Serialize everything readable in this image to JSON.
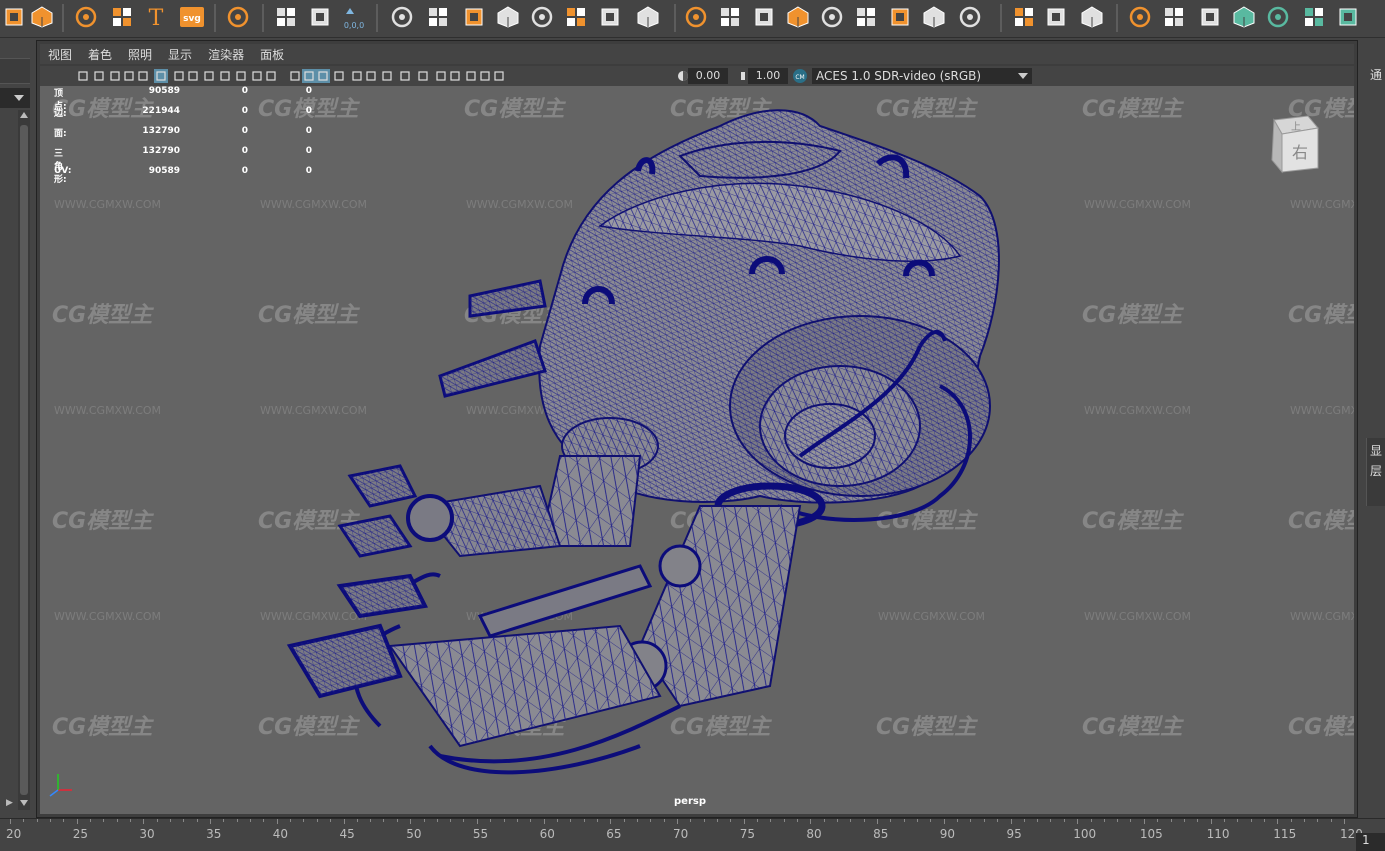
{
  "shelf": {
    "icons": [
      "partial-icon",
      "polygon-sphere-icon",
      "sparkle-icon",
      "spring-helix-icon",
      "text-T-icon",
      "svg-icon",
      "grid-panel-icon",
      "target-icon",
      "scale-cursor-icon",
      "pivot-reset-icon",
      "combine-icon",
      "boolean-icon",
      "extract-icon",
      "separate-icon",
      "smooth-icon",
      "cleanup-icon",
      "transfer-icon",
      "mirror-icon",
      "extrude-icon",
      "bridge-icon",
      "bevel-icon",
      "append-icon",
      "multicut-icon",
      "fill-hole-icon",
      "wedge-icon",
      "poke-icon",
      "circularize-icon",
      "combine-edges-icon",
      "target-weld-icon",
      "edge-flow-icon",
      "pencil-icon",
      "lattice-icon",
      "paint-icon",
      "uv-cube-icon",
      "uv-cylinder-icon",
      "uv-planar-icon",
      "uv-layout-icon",
      "uv-unfold-icon",
      "uv-checker-icon",
      "uv-grid-icon"
    ],
    "svg_label": "svg",
    "coord_label": "0,0,0"
  },
  "left": {
    "bottom_arrow": "▶"
  },
  "right": {
    "top_label": "通",
    "mid_label_1": "显",
    "mid_label_2": "层"
  },
  "viewport_menu": {
    "items": [
      "视图",
      "着色",
      "照明",
      "显示",
      "渲染器",
      "面板"
    ]
  },
  "viewport_toolbar": {
    "exposure": "0.00",
    "gamma": "1.00",
    "color_space": "ACES 1.0 SDR-video (sRGB)"
  },
  "hud": {
    "rows": [
      {
        "label": "顶点:",
        "v1": "90589",
        "v2": "0",
        "v3": "0"
      },
      {
        "label": "边:",
        "v1": "221944",
        "v2": "0",
        "v3": "0"
      },
      {
        "label": "面:",
        "v1": "132790",
        "v2": "0",
        "v3": "0"
      },
      {
        "label": "三角形:",
        "v1": "132790",
        "v2": "0",
        "v3": "0"
      },
      {
        "label": "UV:",
        "v1": "90589",
        "v2": "0",
        "v3": "0"
      }
    ]
  },
  "viewcube": {
    "face_top": "上",
    "face_right": "右"
  },
  "camera": "persp",
  "watermark": {
    "logo": "CG模型主",
    "url": "WWW.CGMXW.COM"
  },
  "timeline": {
    "ticks": [
      "20",
      "25",
      "30",
      "35",
      "40",
      "45",
      "50",
      "55",
      "60",
      "65",
      "70",
      "75",
      "80",
      "85",
      "90",
      "95",
      "100",
      "105",
      "110",
      "115",
      "120"
    ],
    "current_frame": "1"
  }
}
